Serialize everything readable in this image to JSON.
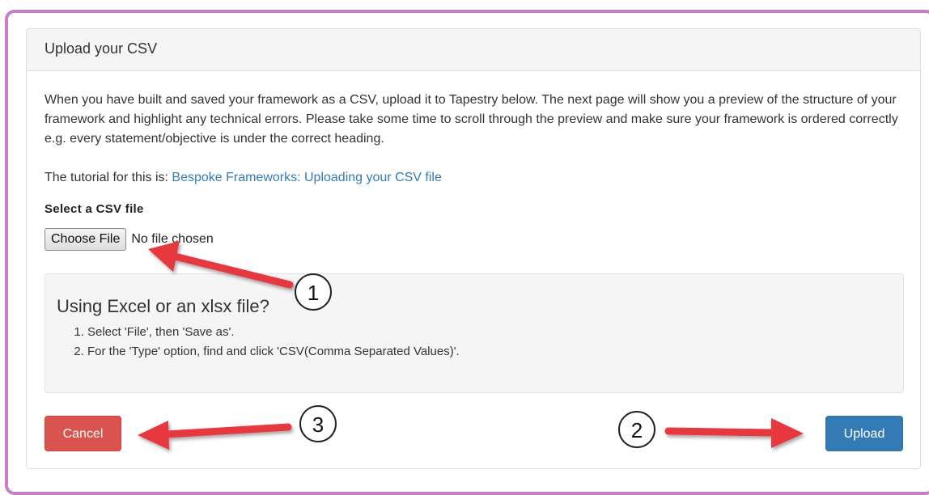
{
  "panel": {
    "heading": "Upload your CSV",
    "description": "When you have built and saved your framework as a CSV, upload it to Tapestry below. The next page will show you a preview of the structure of your framework and highlight any technical errors. Please take some time to scroll through the preview and make sure your framework is ordered correctly e.g. every statement/objective is under the correct heading.",
    "tutorial_prefix": "The tutorial for this is: ",
    "tutorial_link": "Bespoke Frameworks: Uploading your CSV file"
  },
  "file_input": {
    "label": "Select a CSV file",
    "button_label": "Choose File",
    "status": "No file chosen"
  },
  "excel_help": {
    "title": "Using Excel or an xlsx file?",
    "steps": [
      "Select 'File', then 'Save as'.",
      "For the 'Type' option, find and click 'CSV(Comma Separated Values)'."
    ]
  },
  "actions": {
    "cancel_label": "Cancel",
    "upload_label": "Upload"
  },
  "annotations": {
    "callout_1": "1",
    "callout_2": "2",
    "callout_3": "3",
    "arrow_color": "#e8383d"
  },
  "colors": {
    "frame_border": "#c77dc9",
    "link": "#337ab7",
    "cancel": "#d9534f",
    "upload": "#337ab7"
  }
}
